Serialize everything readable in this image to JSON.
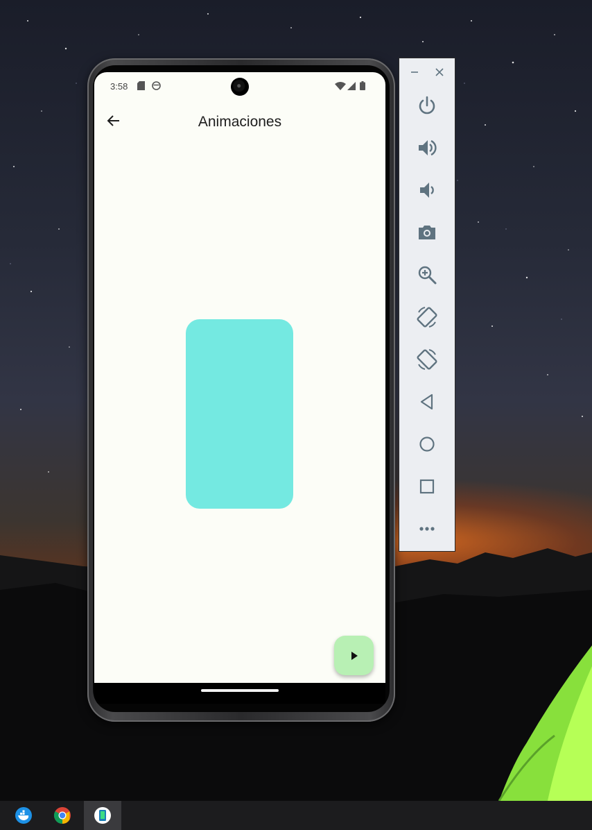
{
  "app": {
    "title": "Animaciones"
  },
  "status_bar": {
    "time": "3:58",
    "icons": [
      "sd-card-icon",
      "face-icon",
      "wifi-icon",
      "cell-signal-icon",
      "battery-icon"
    ]
  },
  "animated_box": {
    "color": "#74e9e1"
  },
  "fab": {
    "icon": "play-icon",
    "color": "#b8f0b4"
  },
  "emulator_toolbar": {
    "window_controls": [
      "minimize-icon",
      "close-icon"
    ],
    "buttons": [
      "power-icon",
      "volume-up-icon",
      "volume-down-icon",
      "camera-icon",
      "zoom-icon",
      "rotate-left-icon",
      "rotate-right-icon",
      "back-icon",
      "home-icon",
      "overview-icon",
      "more-icon"
    ],
    "icon_color": "#5f7380"
  },
  "taskbar": {
    "apps": [
      "docker-icon",
      "chrome-icon",
      "android-emulator-icon"
    ],
    "active_app": "android-emulator-icon"
  }
}
